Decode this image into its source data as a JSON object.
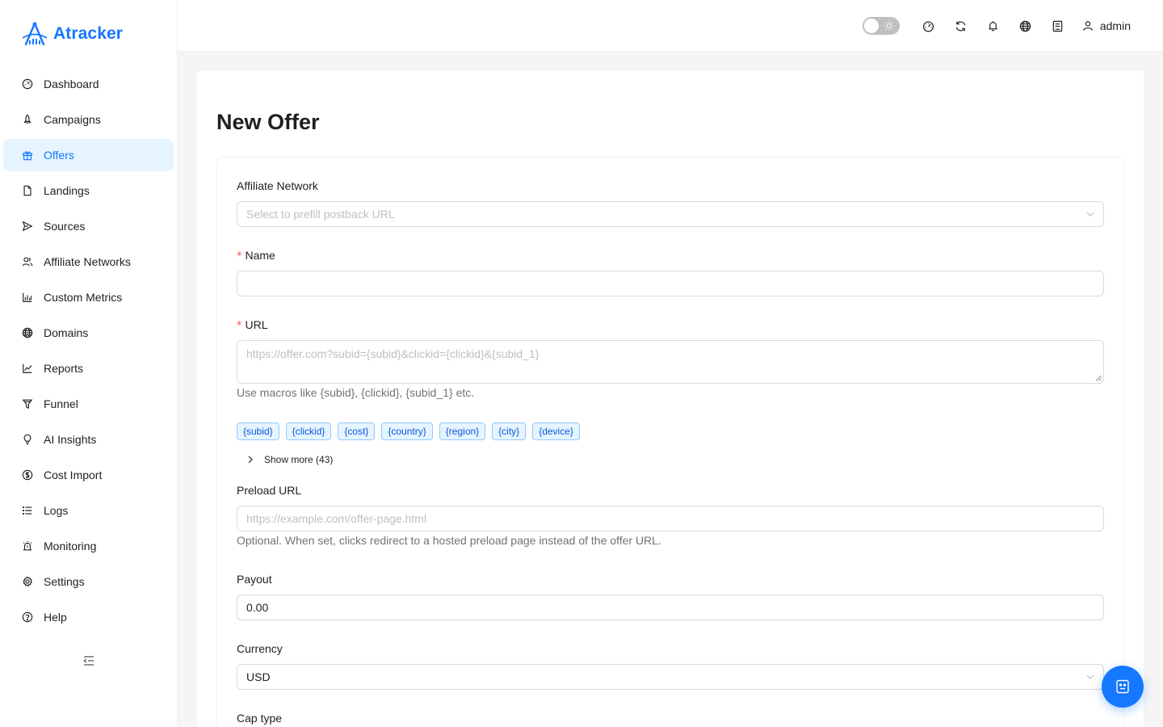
{
  "app": {
    "name": "Atracker",
    "brand_color": "#1677ff"
  },
  "sidebar": {
    "items": [
      {
        "label": "Dashboard",
        "icon": "dashboard-icon",
        "active": false
      },
      {
        "label": "Campaigns",
        "icon": "rocket-icon",
        "active": false
      },
      {
        "label": "Offers",
        "icon": "gift-icon",
        "active": true
      },
      {
        "label": "Landings",
        "icon": "file-icon",
        "active": false
      },
      {
        "label": "Sources",
        "icon": "send-icon",
        "active": false
      },
      {
        "label": "Affiliate Networks",
        "icon": "users-icon",
        "active": false
      },
      {
        "label": "Custom Metrics",
        "icon": "bar-chart-icon",
        "active": false
      },
      {
        "label": "Domains",
        "icon": "globe-icon",
        "active": false
      },
      {
        "label": "Reports",
        "icon": "line-chart-icon",
        "active": false
      },
      {
        "label": "Funnel",
        "icon": "funnel-icon",
        "active": false
      },
      {
        "label": "AI Insights",
        "icon": "bulb-icon",
        "active": false
      },
      {
        "label": "Cost Import",
        "icon": "dollar-icon",
        "active": false
      },
      {
        "label": "Logs",
        "icon": "list-icon",
        "active": false
      },
      {
        "label": "Monitoring",
        "icon": "alert-icon",
        "active": false
      },
      {
        "label": "Settings",
        "icon": "gear-icon",
        "active": false
      },
      {
        "label": "Help",
        "icon": "question-icon",
        "active": false
      }
    ]
  },
  "header": {
    "user": "admin",
    "theme_toggle_on": false
  },
  "page": {
    "title": "New Offer"
  },
  "form": {
    "affiliate_network": {
      "label": "Affiliate Network",
      "placeholder": "Select to prefill postback URL"
    },
    "name": {
      "label": "Name",
      "value": ""
    },
    "url": {
      "label": "URL",
      "placeholder": "https://offer.com?subid={subid}&clickid={clickid}&{subid_1}",
      "help": "Use macros like {subid}, {clickid}, {subid_1} etc."
    },
    "macros": [
      "{subid}",
      "{clickid}",
      "{cost}",
      "{country}",
      "{region}",
      "{city}",
      "{device}"
    ],
    "show_more": "Show more (43)",
    "preload_url": {
      "label": "Preload URL",
      "placeholder": "https://example.com/offer-page.html",
      "help": "Optional. When set, clicks redirect to a hosted preload page instead of the offer URL."
    },
    "payout": {
      "label": "Payout",
      "value": "0.00"
    },
    "currency": {
      "label": "Currency",
      "value": "USD"
    },
    "cap_type": {
      "label": "Cap type"
    }
  }
}
